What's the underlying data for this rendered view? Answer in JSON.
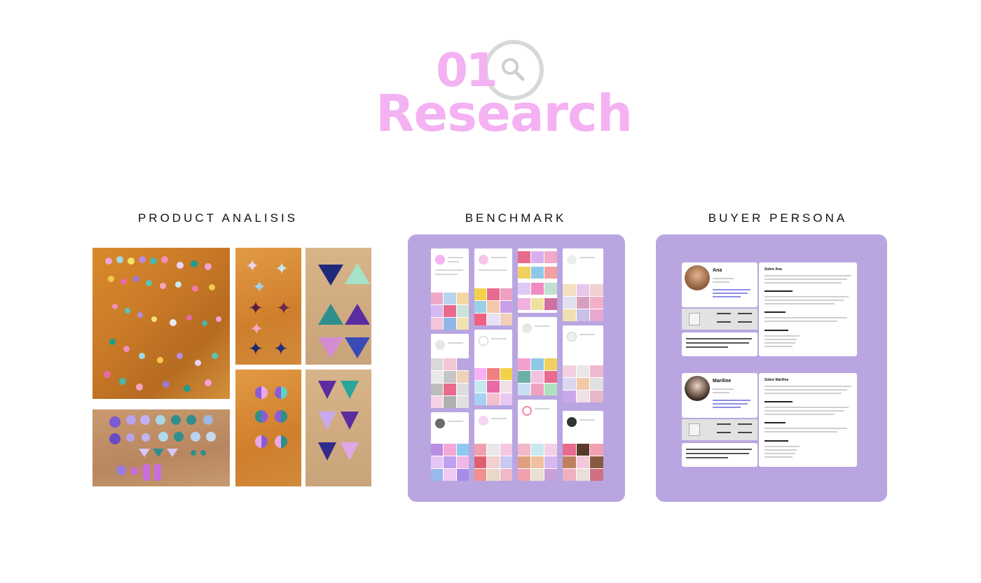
{
  "header": {
    "number": "01",
    "title": "Research"
  },
  "sections": [
    {
      "title": "PRODUCT ANALISIS"
    },
    {
      "title": "BENCHMARK"
    },
    {
      "title": "BUYER PERSONA"
    }
  ],
  "personas": [
    {
      "name": "Ana",
      "about_heading": "Sobre Ana"
    },
    {
      "name": "Mariline",
      "about_heading": "Sobre Mariline"
    }
  ],
  "colors": {
    "accent_pink": "#f4b2f2",
    "panel_purple": "#b9a6e1",
    "icon_grey": "#d8d8d8"
  },
  "icons": [
    "search-icon"
  ]
}
